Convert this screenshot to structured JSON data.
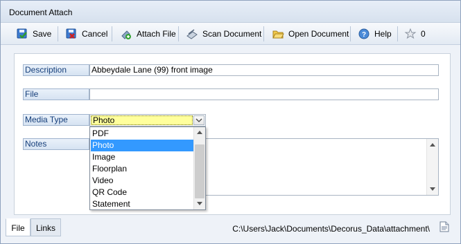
{
  "window": {
    "title": "Document Attach"
  },
  "toolbar": {
    "save": "Save",
    "cancel": "Cancel",
    "attach_file": "Attach File",
    "scan_document": "Scan Document",
    "open_document": "Open Document",
    "help": "Help",
    "favorite_count": "0"
  },
  "form": {
    "description_label": "Description",
    "description_value": "Abbeydale Lane (99) front image",
    "file_label": "File",
    "file_value": "",
    "media_type_label": "Media Type",
    "media_type_value": "Photo",
    "notes_label": "Notes",
    "notes_value": ""
  },
  "media_options": [
    "PDF",
    "Photo",
    "Image",
    "Floorplan",
    "Video",
    "QR Code",
    "Statement"
  ],
  "tabs": {
    "file": "File",
    "links": "Links"
  },
  "status": {
    "path": "C:\\Users\\Jack\\Documents\\Decorus_Data\\attachment\\"
  }
}
